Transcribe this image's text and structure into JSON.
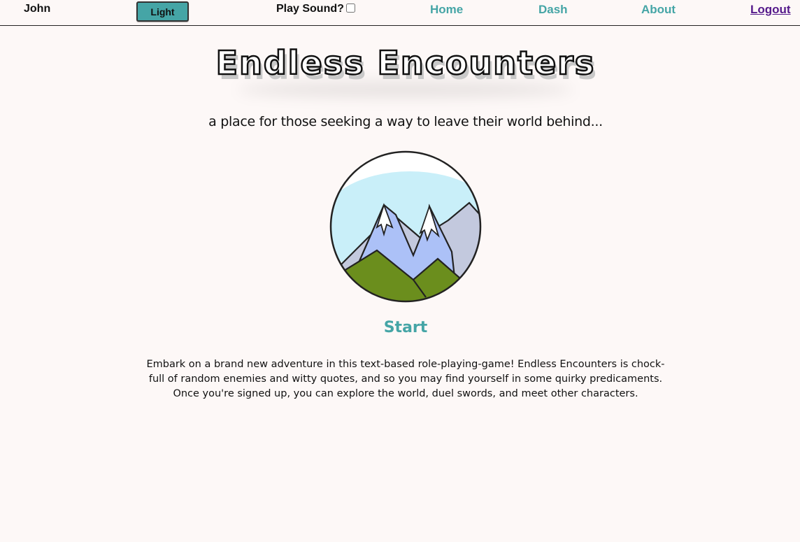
{
  "nav": {
    "user": "John",
    "theme_button": "Light",
    "sound_label": "Play Sound?",
    "sound_checked": false,
    "home": "Home",
    "dash": "Dash",
    "about": "About",
    "logout": "Logout",
    "accent_color": "#45a5a6",
    "visited_link_color": "#551a8b"
  },
  "hero": {
    "title": "Endless Encounters",
    "subtitle": "a place for those seeking a way to leave their world behind...",
    "logo_icon": "mountain-emblem-icon",
    "start": "Start",
    "description": "Embark on a brand new adventure in this text-based role-playing-game! Endless Encounters is chock-full of random enemies and witty quotes, and so you may find yourself in some quirky predicaments. Once you're signed up, you can explore the world, duel swords, and meet other characters."
  },
  "colors": {
    "background": "#fdf8f7",
    "sky": "#c9eff9",
    "mountain_back": "#c3c9de",
    "mountain_front": "#acc1f7",
    "hills": "#6b8e1d"
  }
}
